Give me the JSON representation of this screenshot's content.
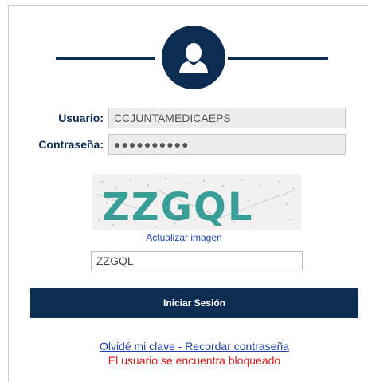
{
  "login": {
    "user_label": "Usuario:",
    "user_value": "CCJUNTAMEDICAEPS",
    "password_label": "Contraseña:",
    "password_value": "●●●●●●●●●●",
    "captcha_image_text": "ZZGQL",
    "captcha_refresh_label": "Actualizar imagen",
    "captcha_input_value": "ZZGQL",
    "submit_label": "Iniciar Sesión",
    "forgot_label": "Olvidé mi clave - Recordar contraseña",
    "error_message": "El usuario se encuentra bloqueado"
  },
  "colors": {
    "brand_navy": "#0b2d52",
    "link_blue": "#1a3fb8",
    "error_red": "#e01515",
    "captcha_teal": "#3a9e98"
  },
  "icons": {
    "avatar": "user-silhouette-icon"
  }
}
